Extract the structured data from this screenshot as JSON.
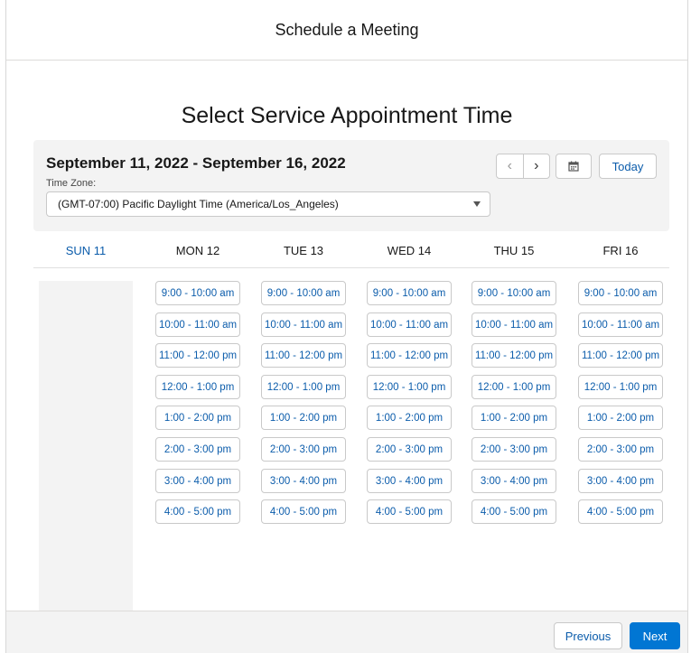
{
  "header": {
    "title": "Schedule a Meeting"
  },
  "heading": "Select Service Appointment Time",
  "toolbar": {
    "date_range": "September 11, 2022 - September 16, 2022",
    "timezone_label": "Time Zone:",
    "timezone_value": "(GMT-07:00) Pacific Daylight Time (America/Los_Angeles)",
    "prev_icon": "chevron-left-icon",
    "next_icon": "chevron-right-icon",
    "calendar_icon": "calendar-icon",
    "today_label": "Today"
  },
  "days": [
    {
      "label": "SUN 11",
      "active": true,
      "slots": []
    },
    {
      "label": "MON 12",
      "active": false,
      "slots": [
        "9:00 - 10:00 am",
        "10:00 - 11:00 am",
        "11:00 - 12:00 pm",
        "12:00 - 1:00 pm",
        "1:00 - 2:00 pm",
        "2:00 - 3:00 pm",
        "3:00 - 4:00 pm",
        "4:00 - 5:00 pm"
      ]
    },
    {
      "label": "TUE 13",
      "active": false,
      "slots": [
        "9:00 - 10:00 am",
        "10:00 - 11:00 am",
        "11:00 - 12:00 pm",
        "12:00 - 1:00 pm",
        "1:00 - 2:00 pm",
        "2:00 - 3:00 pm",
        "3:00 - 4:00 pm",
        "4:00 - 5:00 pm"
      ]
    },
    {
      "label": "WED 14",
      "active": false,
      "slots": [
        "9:00 - 10:00 am",
        "10:00 - 11:00 am",
        "11:00 - 12:00 pm",
        "12:00 - 1:00 pm",
        "1:00 - 2:00 pm",
        "2:00 - 3:00 pm",
        "3:00 - 4:00 pm",
        "4:00 - 5:00 pm"
      ]
    },
    {
      "label": "THU 15",
      "active": false,
      "slots": [
        "9:00 - 10:00 am",
        "10:00 - 11:00 am",
        "11:00 - 12:00 pm",
        "12:00 - 1:00 pm",
        "1:00 - 2:00 pm",
        "2:00 - 3:00 pm",
        "3:00 - 4:00 pm",
        "4:00 - 5:00 pm"
      ]
    },
    {
      "label": "FRI 16",
      "active": false,
      "slots": [
        "9:00 - 10:00 am",
        "10:00 - 11:00 am",
        "11:00 - 12:00 pm",
        "12:00 - 1:00 pm",
        "1:00 - 2:00 pm",
        "2:00 - 3:00 pm",
        "3:00 - 4:00 pm",
        "4:00 - 5:00 pm"
      ]
    }
  ],
  "footer": {
    "previous_label": "Previous",
    "next_label": "Next"
  },
  "colors": {
    "accent": "#0176d3",
    "link": "#0b5cab",
    "panel": "#f3f3f3"
  }
}
